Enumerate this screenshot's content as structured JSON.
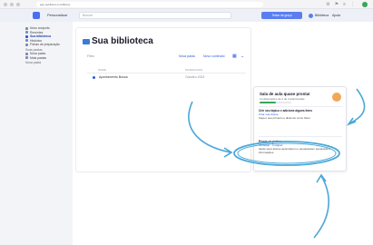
{
  "browser": {
    "url": "app.publisher.com/library",
    "extension_icons": [
      "⚙",
      "⚑",
      "≡",
      "⋮"
    ]
  },
  "header": {
    "personalize_label": "Personalizar",
    "search_placeholder": "Buscar",
    "trial_button": "Testar de graça",
    "library_button": "Biblioteca",
    "help_button": "Ajuda"
  },
  "sidebar": {
    "items": [
      {
        "label": "Novo conjunto",
        "kind": "item"
      },
      {
        "label": "Recentes",
        "kind": "item"
      },
      {
        "label": "Sua biblioteca",
        "kind": "active"
      },
      {
        "label": "Histórico",
        "kind": "item"
      },
      {
        "label": "Fichas de preparação",
        "kind": "item"
      },
      {
        "label": "Suas pastas",
        "kind": "group"
      },
      {
        "label": "Nova pasta",
        "kind": "item"
      },
      {
        "label": "Mais pastas",
        "kind": "item"
      },
      {
        "label": "Nova pasta",
        "kind": "group"
      }
    ]
  },
  "main": {
    "title": "Sua biblioteca",
    "filter_label": "Filtro",
    "new_folder": "Nova pasta",
    "new_content": "Novo conteúdo",
    "grid_icon": "grid-icon",
    "more_icon": "more-icon",
    "col_name": "NOME",
    "col_date": "MODIFICADO",
    "rows": [
      {
        "name": "Apontamento Busca",
        "date": "Outubro 2024"
      }
    ]
  },
  "panel": {
    "title": "Sala de aula quase pronta!",
    "subtitle": "Configurações de 2 de 4 adicionadas",
    "progress": 0.5,
    "close": "×",
    "step1_title": "Crie seu tópico e adicione alguns itens",
    "step1_link": "Criar sua classe",
    "step1_text": "Faça o seu primeiro e dicas de como fazer.",
    "step2_title": "Pegue os partes",
    "step2_link": "Começar · 4 etapas",
    "step2_text": "Ajude seus alunos aprenderem e pesquisarem pesquisas e informações."
  },
  "colors": {
    "accent": "#2a56e0",
    "annotation": "#4aa8d8",
    "success": "#3aa55a"
  }
}
